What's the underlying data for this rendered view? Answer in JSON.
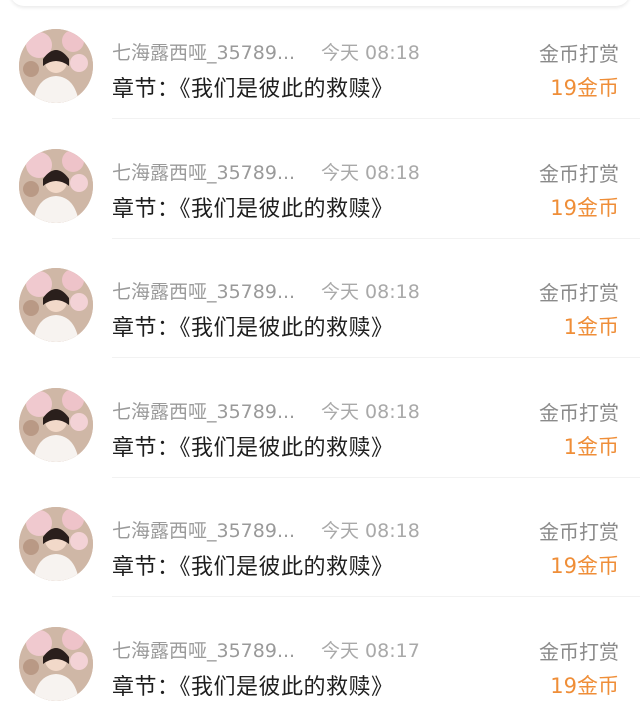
{
  "records": [
    {
      "name": "七海露西哑_35789...",
      "time": "今天 08:18",
      "type": "金币打赏",
      "chapter": "章节：《我们是彼此的救赎》",
      "amount": "19金币"
    },
    {
      "name": "七海露西哑_35789...",
      "time": "今天 08:18",
      "type": "金币打赏",
      "chapter": "章节：《我们是彼此的救赎》",
      "amount": "19金币"
    },
    {
      "name": "七海露西哑_35789...",
      "time": "今天 08:18",
      "type": "金币打赏",
      "chapter": "章节：《我们是彼此的救赎》",
      "amount": "1金币"
    },
    {
      "name": "七海露西哑_35789...",
      "time": "今天 08:18",
      "type": "金币打赏",
      "chapter": "章节：《我们是彼此的救赎》",
      "amount": "1金币"
    },
    {
      "name": "七海露西哑_35789...",
      "time": "今天 08:18",
      "type": "金币打赏",
      "chapter": "章节：《我们是彼此的救赎》",
      "amount": "19金币"
    },
    {
      "name": "七海露西哑_35789...",
      "time": "今天 08:17",
      "type": "金币打赏",
      "chapter": "章节：《我们是彼此的救赎》",
      "amount": "19金币"
    }
  ],
  "colors": {
    "amount": "#ef8e38",
    "muted_text": "#9a9a9a",
    "primary_text": "#1f1f1f"
  }
}
